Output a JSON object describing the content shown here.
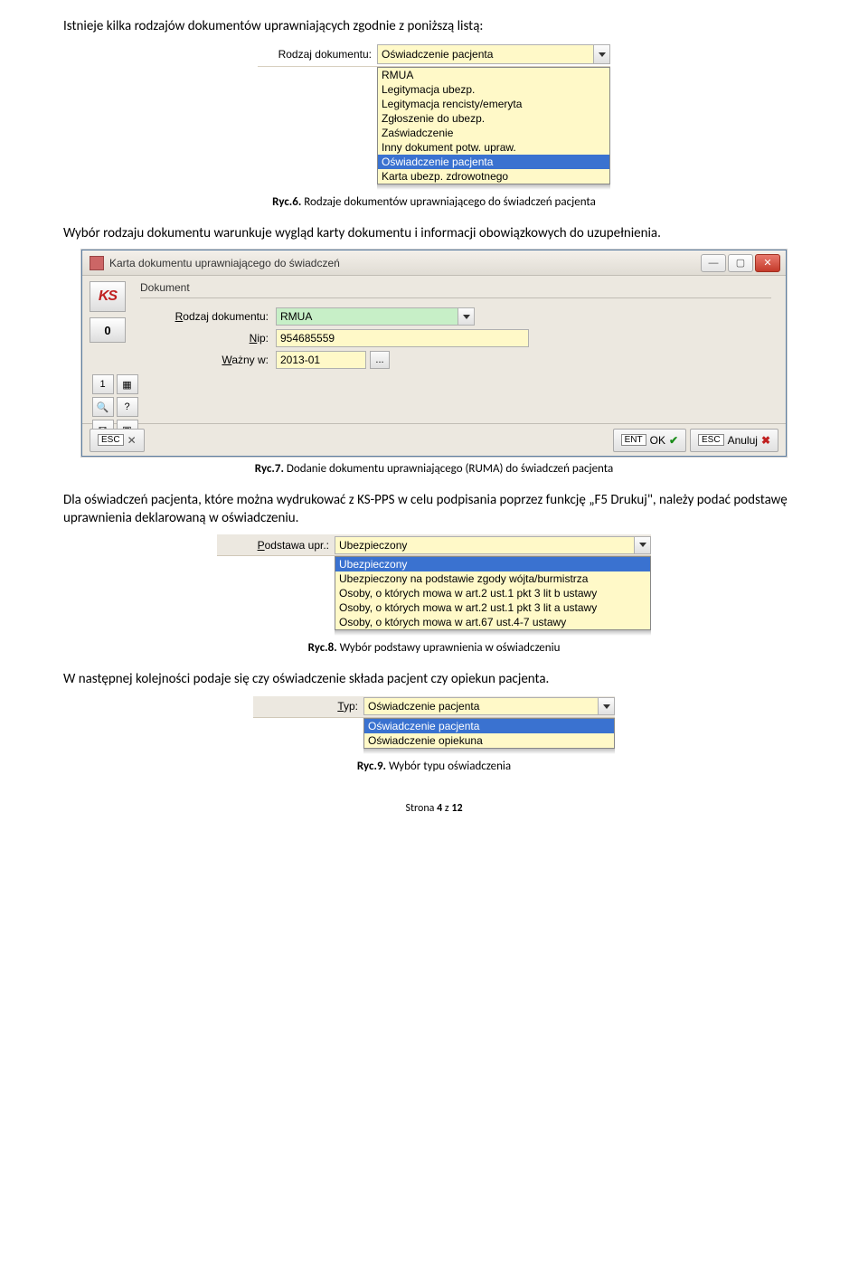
{
  "para1": "Istnieje kilka rodzajów dokumentów uprawniających zgodnie z poniższą listą:",
  "dd1": {
    "label": "Rodzaj dokumentu:",
    "value": "Oświadczenie pacjenta",
    "items": [
      "RMUA",
      "Legitymacja ubezp.",
      "Legitymacja rencisty/emeryta",
      "Zgłoszenie do ubezp.",
      "Zaświadczenie",
      "Inny dokument potw. upraw.",
      "Oświadczenie pacjenta",
      "Karta ubezp. zdrowotnego"
    ],
    "selected_index": 6
  },
  "cap6_b": "Ryc.6.",
  "cap6": " Rodzaje dokumentów uprawniającego do świadczeń pacjenta",
  "para2": "Wybór rodzaju dokumentu warunkuje wygląd karty dokumentu i informacji obowiązkowych do uzupełnienia.",
  "win": {
    "title": "Karta dokumentu uprawniającego do świadczeń",
    "logo": "KS",
    "zero": "0",
    "group": "Dokument",
    "row1_label": "Rodzaj dokumentu:",
    "row1_value": "RMUA",
    "row2_label": "Nip:",
    "row2_value": "954685559",
    "row3_label": "Ważny w:",
    "row3_value": "2013-01",
    "dots": "...",
    "esc_small": "ESC",
    "ent_ok": "ENT",
    "ok": "OK",
    "esc_big": "ESC",
    "anuluj": "Anuluj",
    "sb_q": "?",
    "sb_1": "1",
    "sb_calc": "▦",
    "sb_mail": "✉",
    "sb_photo": "▣"
  },
  "cap7_b": "Ryc.7.",
  "cap7": " Dodanie dokumentu uprawniającego (RUMA) do świadczeń pacjenta",
  "para3": "Dla oświadczeń pacjenta, które można wydrukować z KS-PPS w celu podpisania poprzez funkcję „F5 Drukuj\", należy podać podstawę uprawnienia deklarowaną w oświadczeniu.",
  "dd2": {
    "label": "Podstawa upr.:",
    "value": "Ubezpieczony",
    "items": [
      "Ubezpieczony",
      "Ubezpieczony na podstawie zgody wójta/burmistrza",
      "Osoby, o których mowa w art.2 ust.1 pkt 3 lit b ustawy",
      "Osoby, o których mowa w art.2 ust.1 pkt 3 lit a ustawy",
      "Osoby, o których mowa w art.67 ust.4-7 ustawy"
    ],
    "selected_index": 0
  },
  "cap8_b": "Ryc.8.",
  "cap8": " Wybór podstawy uprawnienia w oświadczeniu",
  "para4": "W następnej kolejności podaje się czy oświadczenie składa pacjent czy opiekun pacjenta.",
  "dd3": {
    "label": "Typ:",
    "value": "Oświadczenie pacjenta",
    "items": [
      "Oświadczenie pacjenta",
      "Oświadczenie opiekuna"
    ],
    "selected_index": 0
  },
  "cap9_b": "Ryc.9.",
  "cap9": " Wybór typu oświadczenia",
  "footer_a": "Strona ",
  "footer_b": "4",
  "footer_c": " z ",
  "footer_d": "12"
}
